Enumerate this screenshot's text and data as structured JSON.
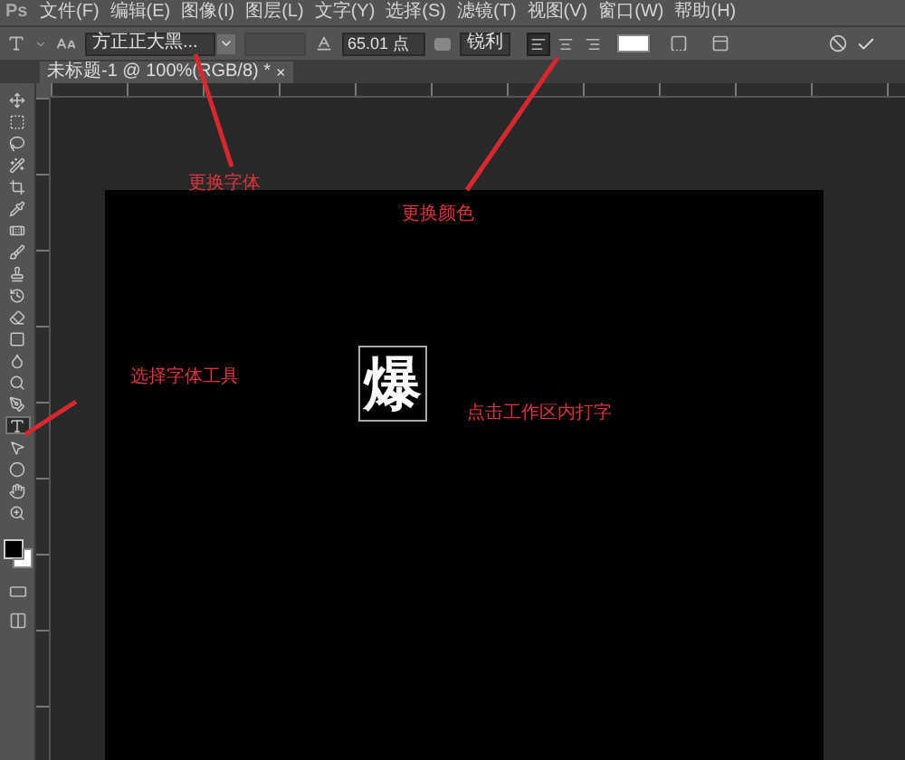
{
  "app": {
    "logo": "Ps"
  },
  "menu": [
    "文件(F)",
    "编辑(E)",
    "图像(I)",
    "图层(L)",
    "文字(Y)",
    "选择(S)",
    "滤镜(T)",
    "视图(V)",
    "窗口(W)",
    "帮助(H)"
  ],
  "options_bar": {
    "font_family": "方正正大黑...",
    "font_size": "65.01 点",
    "antialias": "锐利",
    "swatches": [
      {
        "color": "#ffffff"
      }
    ],
    "alignment": [
      {
        "kind": "left",
        "selected": true
      },
      {
        "kind": "center",
        "selected": false
      },
      {
        "kind": "right",
        "selected": false
      }
    ]
  },
  "document_tab": {
    "title": "未标题-1 @ 100%(RGB/8) *",
    "close": "×"
  },
  "tools": [
    {
      "kind": "move",
      "selected": false
    },
    {
      "kind": "marquee",
      "selected": false
    },
    {
      "kind": "lasso",
      "selected": false
    },
    {
      "kind": "quick-select",
      "selected": false
    },
    {
      "kind": "crop",
      "selected": false
    },
    {
      "kind": "eyedropper",
      "selected": false
    },
    {
      "kind": "healing",
      "selected": false
    },
    {
      "kind": "brush",
      "selected": false
    },
    {
      "kind": "stamp",
      "selected": false
    },
    {
      "kind": "history",
      "selected": false
    },
    {
      "kind": "eraser",
      "selected": false
    },
    {
      "kind": "gradient",
      "selected": false
    },
    {
      "kind": "blur",
      "selected": false
    },
    {
      "kind": "dodge",
      "selected": false
    },
    {
      "kind": "pen",
      "selected": false
    },
    {
      "kind": "type",
      "selected": true
    },
    {
      "kind": "path-select",
      "selected": false
    },
    {
      "kind": "shape",
      "selected": false
    },
    {
      "kind": "hand",
      "selected": false
    },
    {
      "kind": "zoom",
      "selected": false
    }
  ],
  "colors": [
    {
      "kind": "foreground",
      "color": "#000000"
    },
    {
      "kind": "background",
      "color": "#ffffff"
    }
  ],
  "canvas": {
    "text": "爆"
  },
  "annotations": [
    {
      "text": "更换字体"
    },
    {
      "text": "更换颜色"
    },
    {
      "text": "选择字体工具"
    },
    {
      "text": "点击工作区内打字"
    }
  ]
}
